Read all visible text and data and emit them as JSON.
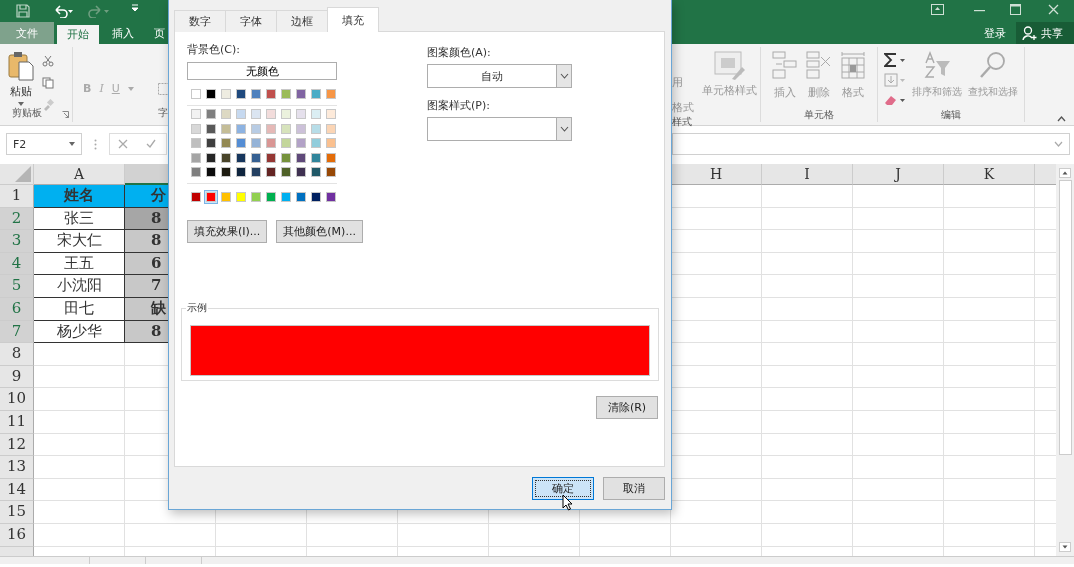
{
  "ribbon_tabs": [
    {
      "label": "文件",
      "selected": false
    },
    {
      "label": "开始",
      "selected": true
    },
    {
      "label": "插入",
      "selected": false
    },
    {
      "label": "页",
      "selected": false
    }
  ],
  "account": {
    "sign_in": "登录",
    "share": "共享"
  },
  "clipboard_group": {
    "paste": "粘贴",
    "label": "剪贴板"
  },
  "font_group": {
    "bold": "B",
    "italic": "I",
    "underline": "U",
    "label": "字"
  },
  "styles_group": {
    "table_format_line1": "用",
    "table_format_line2": "格式",
    "label": "样式",
    "cell_styles": "单元格样式"
  },
  "cells_group": {
    "insert": "插入",
    "delete": "删除",
    "format": "格式",
    "label": "单元格"
  },
  "editing_group": {
    "sort_filter": "排序和筛选",
    "find_select": "查找和选择",
    "label": "编辑"
  },
  "formula_bar": {
    "name_box": "F2"
  },
  "column_headers": [
    {
      "label": "A",
      "selected": false
    },
    {
      "selected": true
    },
    {
      "label": "H",
      "selected": false
    },
    {
      "label": "I",
      "selected": false
    },
    {
      "label": "J",
      "selected": false
    },
    {
      "label": "K",
      "selected": false
    }
  ],
  "rows": [
    {
      "number": "1",
      "selected": false,
      "cells": [
        {
          "text": "姓名",
          "color": "#00b0f0",
          "bold": true
        },
        {
          "text": "分",
          "color": "#00b0f0"
        }
      ]
    },
    {
      "number": "2",
      "selected": true,
      "cells": [
        {
          "text": "张三",
          "color": "#ffffff",
          "bold": false
        },
        {
          "text": "8",
          "color": "#a6a6a6"
        }
      ]
    },
    {
      "number": "3",
      "selected": true,
      "cells": [
        {
          "text": "宋大仁",
          "color": "#ffffff",
          "bold": false
        },
        {
          "text": "8",
          "color": "#c8c8c8"
        }
      ]
    },
    {
      "number": "4",
      "selected": true,
      "cells": [
        {
          "text": "王五",
          "color": "#ffffff",
          "bold": false
        },
        {
          "text": "6",
          "color": "#c8c8c8"
        }
      ]
    },
    {
      "number": "5",
      "selected": true,
      "cells": [
        {
          "text": "小沈阳",
          "color": "#ffffff",
          "bold": false
        },
        {
          "text": "7",
          "color": "#c8c8c8"
        }
      ]
    },
    {
      "number": "6",
      "selected": true,
      "cells": [
        {
          "text": "田七",
          "color": "#ffffff",
          "bold": false
        },
        {
          "text": "缺",
          "color": "#c8c8c8"
        }
      ]
    },
    {
      "number": "7",
      "selected": true,
      "cells": [
        {
          "text": "杨少华",
          "color": "#ffffff",
          "bold": false
        },
        {
          "text": "8",
          "color": "#c8c8c8"
        }
      ]
    },
    {
      "number": "8",
      "selected": false
    },
    {
      "number": "9",
      "selected": false
    },
    {
      "number": "10",
      "selected": false
    },
    {
      "number": "11",
      "selected": false
    },
    {
      "number": "12",
      "selected": false
    },
    {
      "number": "13",
      "selected": false
    },
    {
      "number": "14",
      "selected": false
    },
    {
      "number": "15",
      "selected": false
    },
    {
      "number": "16",
      "selected": false
    }
  ],
  "dialog": {
    "tabs": [
      {
        "label": "数字",
        "selected": false
      },
      {
        "label": "字体",
        "selected": false
      },
      {
        "label": "边框",
        "selected": false
      },
      {
        "label": "填充",
        "selected": true
      }
    ],
    "background_color": {
      "label": "背景色(C):",
      "button": "无颜色"
    },
    "theme_colors": [
      {
        "color": "#ffffff"
      },
      {
        "color": "#000000"
      },
      {
        "color": "#eeece1"
      },
      {
        "color": "#1f497d"
      },
      {
        "color": "#4f81bd"
      },
      {
        "color": "#c0504d"
      },
      {
        "color": "#9bbb59"
      },
      {
        "color": "#8064a2"
      },
      {
        "color": "#4bacc6"
      },
      {
        "color": "#f79646"
      }
    ],
    "tint_rows": [
      [
        {
          "color": "#f2f2f2"
        },
        {
          "color": "#7f7f7f"
        },
        {
          "color": "#ddd9c3"
        },
        {
          "color": "#c6d9f0"
        },
        {
          "color": "#dbe5f1"
        },
        {
          "color": "#f2dcdb"
        },
        {
          "color": "#ebf1dd"
        },
        {
          "color": "#e5e0ec"
        },
        {
          "color": "#dbeef3"
        },
        {
          "color": "#fdeada"
        }
      ],
      [
        {
          "color": "#d8d8d8"
        },
        {
          "color": "#595959"
        },
        {
          "color": "#c4bd97"
        },
        {
          "color": "#8db3e2"
        },
        {
          "color": "#b8cce4"
        },
        {
          "color": "#e5b9b7"
        },
        {
          "color": "#d7e3bc"
        },
        {
          "color": "#ccc1d9"
        },
        {
          "color": "#b7dde8"
        },
        {
          "color": "#fbd5b5"
        }
      ],
      [
        {
          "color": "#bfbfbf"
        },
        {
          "color": "#3f3f3f"
        },
        {
          "color": "#938953"
        },
        {
          "color": "#548dd4"
        },
        {
          "color": "#95b3d7"
        },
        {
          "color": "#d99694"
        },
        {
          "color": "#c3d69b"
        },
        {
          "color": "#b2a2c7"
        },
        {
          "color": "#92cddc"
        },
        {
          "color": "#fac08f"
        }
      ],
      [
        {
          "color": "#a5a5a5"
        },
        {
          "color": "#262626"
        },
        {
          "color": "#494429"
        },
        {
          "color": "#17365d"
        },
        {
          "color": "#366092"
        },
        {
          "color": "#953734"
        },
        {
          "color": "#76923c"
        },
        {
          "color": "#5f497a"
        },
        {
          "color": "#31859b"
        },
        {
          "color": "#e36c09"
        }
      ],
      [
        {
          "color": "#7f7f7f"
        },
        {
          "color": "#0c0c0c"
        },
        {
          "color": "#1d1b10"
        },
        {
          "color": "#0f243e"
        },
        {
          "color": "#244061"
        },
        {
          "color": "#632423"
        },
        {
          "color": "#4f6128"
        },
        {
          "color": "#3f3151"
        },
        {
          "color": "#205867"
        },
        {
          "color": "#974806"
        }
      ]
    ],
    "standard_colors": [
      {
        "color": "#c00000",
        "selected": false
      },
      {
        "color": "#ff0000",
        "selected": true
      },
      {
        "color": "#ffc000",
        "selected": false
      },
      {
        "color": "#ffff00",
        "selected": false
      },
      {
        "color": "#92d050",
        "selected": false
      },
      {
        "color": "#00b050",
        "selected": false
      },
      {
        "color": "#00b0f0",
        "selected": false
      },
      {
        "color": "#0070c0",
        "selected": false
      },
      {
        "color": "#002060",
        "selected": false
      },
      {
        "color": "#7030a0",
        "selected": false
      }
    ],
    "fill_effects_button": "填充效果(I)...",
    "more_colors_button": "其他颜色(M)...",
    "pattern_color": {
      "label": "图案颜色(A):",
      "value": "自动"
    },
    "pattern_style": {
      "label": "图案样式(P):"
    },
    "sample": {
      "label": "示例"
    },
    "clear_button": "清除(R)",
    "ok_button": "确定",
    "cancel_button": "取消"
  }
}
